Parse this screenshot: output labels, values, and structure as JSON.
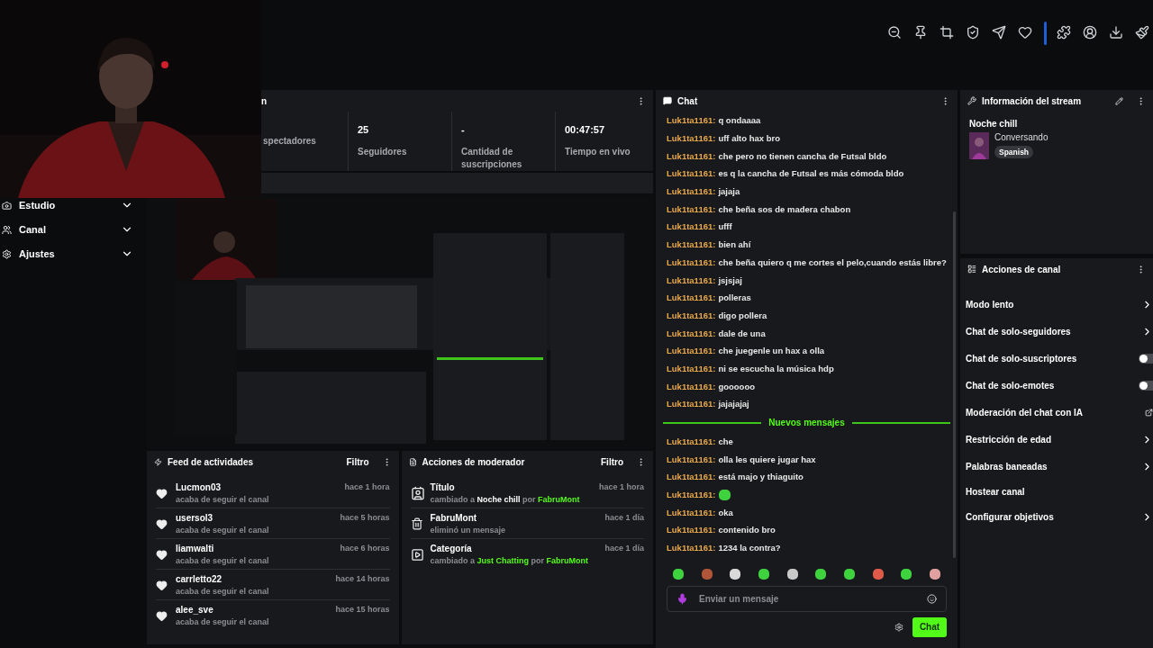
{
  "sidebar": {
    "items": [
      {
        "label": "Estudio",
        "kind": "studio"
      },
      {
        "label": "Canal",
        "kind": "channel"
      },
      {
        "label": "Ajustes",
        "kind": "settings"
      }
    ]
  },
  "stats_panel": {
    "title": "n",
    "stats": [
      {
        "label": "spectadores"
      },
      {
        "value": "25",
        "label": "Seguidores"
      },
      {
        "value": "-",
        "label": "Cantidad de suscripciones"
      },
      {
        "value": "00:47:57",
        "label": "Tiempo en vivo"
      }
    ]
  },
  "chat": {
    "title": "Chat",
    "messages": [
      {
        "user": "Luk1ta1161:",
        "text": "q ondaaaa"
      },
      {
        "user": "Luk1ta1161:",
        "text": "uff alto hax bro"
      },
      {
        "user": "Luk1ta1161:",
        "text": "che pero no tienen cancha de Futsal bldo"
      },
      {
        "user": "Luk1ta1161:",
        "text": "es q la cancha de Futsal es más cómoda bldo"
      },
      {
        "user": "Luk1ta1161:",
        "text": "jajaja"
      },
      {
        "user": "Luk1ta1161:",
        "text": "che beña sos de madera chabon"
      },
      {
        "user": "Luk1ta1161:",
        "text": "ufff"
      },
      {
        "user": "Luk1ta1161:",
        "text": "bien ahí"
      },
      {
        "user": "Luk1ta1161:",
        "text": "che beña quiero q me cortes el pelo,cuando estás libre?"
      },
      {
        "user": "Luk1ta1161:",
        "text": "jsjsjaj"
      },
      {
        "user": "Luk1ta1161:",
        "text": "polleras"
      },
      {
        "user": "Luk1ta1161:",
        "text": "digo pollera"
      },
      {
        "user": "Luk1ta1161:",
        "text": "dale de una"
      },
      {
        "user": "Luk1ta1161:",
        "text": "che juegenle un hax a olla"
      },
      {
        "user": "Luk1ta1161:",
        "text": "ni se escucha la música hdp"
      },
      {
        "user": "Luk1ta1161:",
        "text": "goooooo"
      },
      {
        "user": "Luk1ta1161:",
        "text": "jajajajaj"
      }
    ],
    "new_messages_label": "Nuevos mensajes",
    "new_messages": [
      {
        "user": "Luk1ta1161:",
        "text": "che",
        "kind": "text"
      },
      {
        "user": "Luk1ta1161:",
        "text": "olla les quiere jugar hax",
        "kind": "text"
      },
      {
        "user": "Luk1ta1161:",
        "text": "está majo y thiaguito",
        "kind": "text"
      },
      {
        "user": "Luk1ta1161:",
        "kind": "emote"
      },
      {
        "user": "Luk1ta1161:",
        "text": "oka",
        "kind": "text"
      },
      {
        "user": "Luk1ta1161:",
        "text": "contenido bro",
        "kind": "text"
      },
      {
        "user": "Luk1ta1161:",
        "text": "1234 la contra?",
        "kind": "text"
      }
    ],
    "emotes": [
      {
        "color": "#3fd23f"
      },
      {
        "color": "#b0553a"
      },
      {
        "color": "#d9d9d9"
      },
      {
        "color": "#3fd23f"
      },
      {
        "color": "#c8c8c8"
      },
      {
        "color": "#3fd23f"
      },
      {
        "color": "#3fd23f"
      },
      {
        "color": "#e05a4a"
      },
      {
        "color": "#3fd23f"
      },
      {
        "color": "#e0a0a0"
      }
    ],
    "input": {
      "placeholder": "Enviar un mensaje"
    },
    "send_button": "Chat"
  },
  "stream_info": {
    "title": "Información del stream",
    "stream_title": "Noche chill",
    "category": "Conversando",
    "tag": "Spanish"
  },
  "channel_actions": {
    "title": "Acciones de canal",
    "items": [
      {
        "label": "Modo lento",
        "kind": "arrow"
      },
      {
        "label": "Chat de solo-seguidores",
        "kind": "arrow"
      },
      {
        "label": "Chat de solo-suscriptores",
        "kind": "toggle",
        "on": false
      },
      {
        "label": "Chat de solo-emotes",
        "kind": "toggle",
        "on": false
      },
      {
        "label": "Moderación del chat con IA",
        "kind": "external"
      },
      {
        "label": "Restricción de edad",
        "kind": "arrow"
      },
      {
        "label": "Palabras baneadas",
        "kind": "arrow"
      },
      {
        "label": "Hostear canal",
        "kind": "plain"
      },
      {
        "label": "Configurar objetivos",
        "kind": "arrow"
      }
    ]
  },
  "activity_feed": {
    "title": "Feed de actividades",
    "filter": "Filtro",
    "items": [
      {
        "name": "Lucmon03",
        "time": "hace 1 hora",
        "text": "acaba de seguir el canal"
      },
      {
        "name": "usersol3",
        "time": "hace 5 horas",
        "text": "acaba de seguir el canal"
      },
      {
        "name": "liamwalti",
        "time": "hace 6 horas",
        "text": "acaba de seguir el canal"
      },
      {
        "name": "carrletto22",
        "time": "hace 14 horas",
        "text": "acaba de seguir el canal"
      },
      {
        "name": "alee_sve",
        "time": "hace 15 horas",
        "text": "acaba de seguir el canal"
      }
    ]
  },
  "moderator_actions": {
    "title": "Acciones de moderador",
    "filter": "Filtro",
    "items": [
      {
        "kind": "title",
        "name": "Título",
        "time": "hace 1 hora",
        "parts": [
          {
            "text": "cambiado a "
          },
          {
            "text": "Noche chill",
            "kind": "highlight"
          },
          {
            "text": " por "
          },
          {
            "text": "FabruMont",
            "kind": "user"
          }
        ]
      },
      {
        "kind": "delete",
        "name": "FabruMont",
        "time": "hace 1 día",
        "parts": [
          {
            "text": "eliminó un mensaje"
          }
        ]
      },
      {
        "kind": "category",
        "name": "Categoría",
        "time": "hace 1 día",
        "parts": [
          {
            "text": "cambiado a "
          },
          {
            "text": "Just Chatting",
            "kind": "user"
          },
          {
            "text": " por "
          },
          {
            "text": "FabruMont",
            "kind": "user"
          }
        ]
      }
    ]
  }
}
